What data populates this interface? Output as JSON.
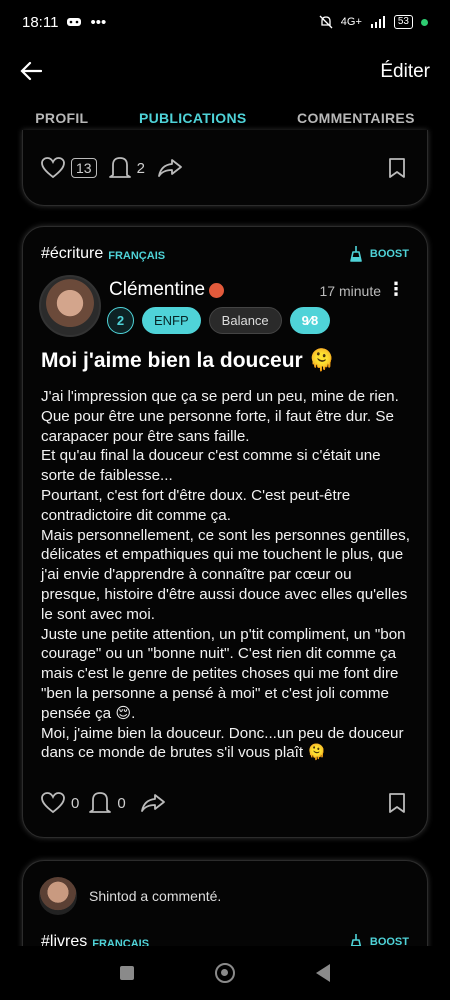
{
  "status": {
    "time": "18:11",
    "network": "4G+",
    "battery": "53"
  },
  "header": {
    "back_label": "←",
    "edit_label": "Éditer"
  },
  "tabs": [
    {
      "label": "PROFIL",
      "active": false
    },
    {
      "label": "PUBLICATIONS",
      "active": true
    },
    {
      "label": "COMMENTAIRES",
      "active": false
    }
  ],
  "prev_post": {
    "likes": "13",
    "comments": "2"
  },
  "post": {
    "hashtag": "#écriture",
    "language": "FRANÇAIS",
    "boost_label": "BOOST",
    "author": "Clémentine",
    "time": "17 minute",
    "level": "2",
    "type": "ENFP",
    "sign": "Balance",
    "score": "9⁄8",
    "title": "Moi j'aime bien la douceur 🫠",
    "body": "J'ai l'impression que ça se perd un peu, mine de rien.\nQue pour être une personne forte, il faut être dur. Se carapacer pour être sans faille.\nEt qu'au final la douceur c'est comme si c'était une sorte de faiblesse...\nPourtant, c'est fort d'être doux. C'est peut-être contradictoire dit comme ça.\nMais personnellement, ce sont les personnes gentilles, délicates et empathiques qui me touchent le plus, que j'ai envie d'apprendre à connaître par cœur ou presque, histoire d'être aussi douce avec elles qu'elles le sont avec moi.\nJuste une petite attention, un p'tit compliment, un \"bon courage\" ou un \"bonne nuit\". C'est rien dit comme ça mais c'est le genre de petites choses qui me font dire \"ben la personne a pensé à moi\" et c'est joli comme pensée ça 😌.\nMoi, j'aime bien la douceur. Donc...un peu de douceur dans ce monde de brutes s'il vous plaît 🫠",
    "likes": "0",
    "comments": "0"
  },
  "next_post": {
    "comment_info": "Shintod a commenté.",
    "hashtag": "#livres",
    "language": "FRANÇAIS",
    "boost_label": "BOOST"
  },
  "colors": {
    "accent": "#4fd3d8",
    "background": "#000000"
  }
}
